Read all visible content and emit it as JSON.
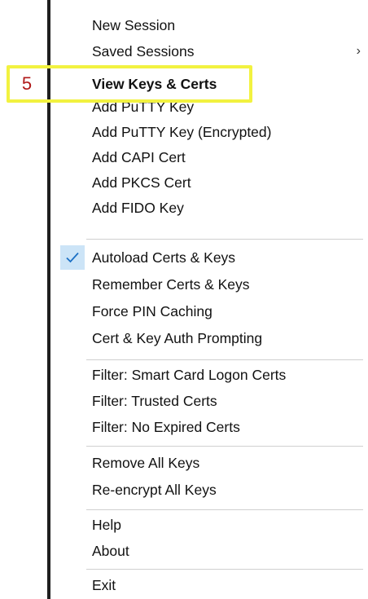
{
  "menu": {
    "items": [
      {
        "key": "new_session",
        "label": "New Session"
      },
      {
        "key": "saved_sessions",
        "label": "Saved Sessions",
        "submenu_glyph": "›"
      },
      {
        "key": "view_keys_certs",
        "label": "View Keys & Certs"
      },
      {
        "key": "add_putty_key",
        "label": "Add PuTTY Key"
      },
      {
        "key": "add_putty_key_encrypted",
        "label": "Add PuTTY Key (Encrypted)"
      },
      {
        "key": "add_capi_cert",
        "label": "Add CAPI Cert"
      },
      {
        "key": "add_pkcs_cert",
        "label": "Add PKCS Cert"
      },
      {
        "key": "add_fido_key",
        "label": "Add FIDO Key"
      },
      {
        "key": "autoload_certs_keys",
        "label": "Autoload Certs & Keys",
        "checked": true
      },
      {
        "key": "remember_certs_keys",
        "label": "Remember Certs & Keys"
      },
      {
        "key": "force_pin_caching",
        "label": "Force PIN Caching"
      },
      {
        "key": "cert_key_auth_prompting",
        "label": "Cert & Key Auth Prompting"
      },
      {
        "key": "filter_smart_card",
        "label": "Filter: Smart Card Logon Certs"
      },
      {
        "key": "filter_trusted",
        "label": "Filter: Trusted Certs"
      },
      {
        "key": "filter_no_expired",
        "label": "Filter: No Expired Certs"
      },
      {
        "key": "remove_all_keys",
        "label": "Remove All Keys"
      },
      {
        "key": "reencrypt_all_keys",
        "label": "Re-encrypt All Keys"
      },
      {
        "key": "help",
        "label": "Help"
      },
      {
        "key": "about",
        "label": "About"
      },
      {
        "key": "exit",
        "label": "Exit"
      }
    ]
  },
  "annotation": {
    "step_number": "5",
    "highlight_color": "#f2f240",
    "number_color": "#b01818"
  },
  "colors": {
    "check_background": "#cce4f7",
    "check_mark": "#1a6fc4",
    "separator": "#d0d0d0"
  },
  "icons": {
    "check": "check-icon",
    "submenu": "chevron-right-icon"
  }
}
